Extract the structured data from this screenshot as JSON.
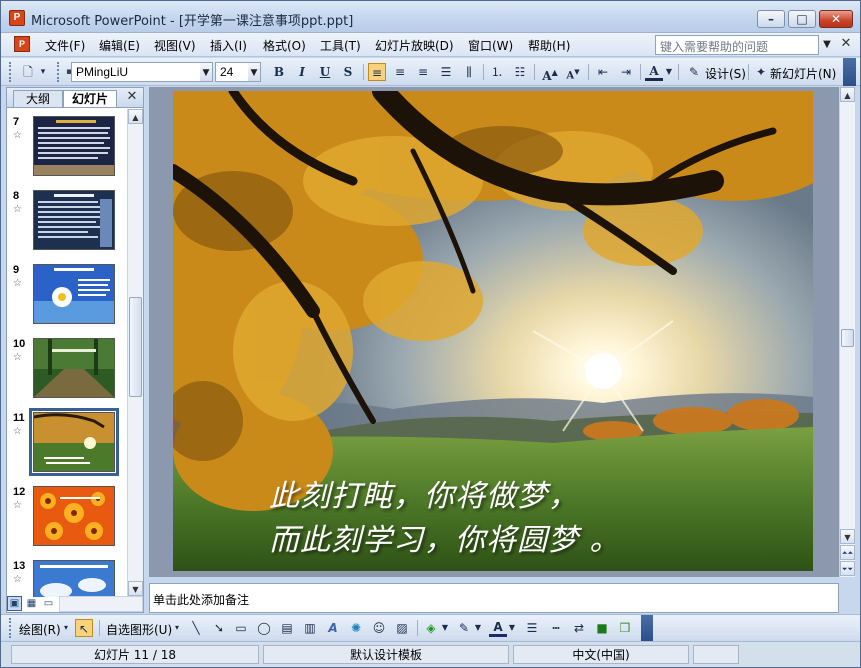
{
  "window": {
    "title": "Microsoft PowerPoint - [开学第一课注意事项ppt.ppt]",
    "app_icon_letter": "P",
    "min_glyph": "–",
    "max_glyph": "□",
    "close_glyph": "✕"
  },
  "menubar": {
    "items": [
      "文件(F)",
      "编辑(E)",
      "视图(V)",
      "插入(I)",
      "格式(O)",
      "工具(T)",
      "幻灯片放映(D)",
      "窗口(W)",
      "帮助(H)"
    ],
    "help_placeholder": "键入需要帮助的问题",
    "doc_icon_letter": "P"
  },
  "toolbar": {
    "font_name": "PMingLiU",
    "font_size": "24",
    "bold": "B",
    "italic": "I",
    "underline": "U",
    "shadow": "S",
    "design_label": "设计(S)",
    "new_slide_label": "新幻灯片(N)"
  },
  "left_pane": {
    "tab_outline": "大纲",
    "tab_slides": "幻灯片",
    "close_glyph": "✕",
    "slides": [
      {
        "num": "7",
        "selected": false
      },
      {
        "num": "8",
        "selected": false
      },
      {
        "num": "9",
        "selected": false
      },
      {
        "num": "10",
        "selected": false
      },
      {
        "num": "11",
        "selected": true
      },
      {
        "num": "12",
        "selected": false
      },
      {
        "num": "13",
        "selected": false
      }
    ],
    "star_glyph": "☆"
  },
  "slide": {
    "line1": "此刻打盹，你将做梦，",
    "line2": "而此刻学习，你将圆梦 。"
  },
  "notes": {
    "placeholder": "单击此处添加备注"
  },
  "drawbar": {
    "draw_label": "绘图(R)",
    "autoshapes_label": "自选图形(U)"
  },
  "status": {
    "slide_info": "幻灯片 11 / 18",
    "template": "默认设计模板",
    "language": "中文(中国)"
  },
  "colors": {
    "title_gradient_top": "#dfe9f6",
    "selection_outline": "#3b5f94",
    "active_button": "#fbd27b"
  }
}
